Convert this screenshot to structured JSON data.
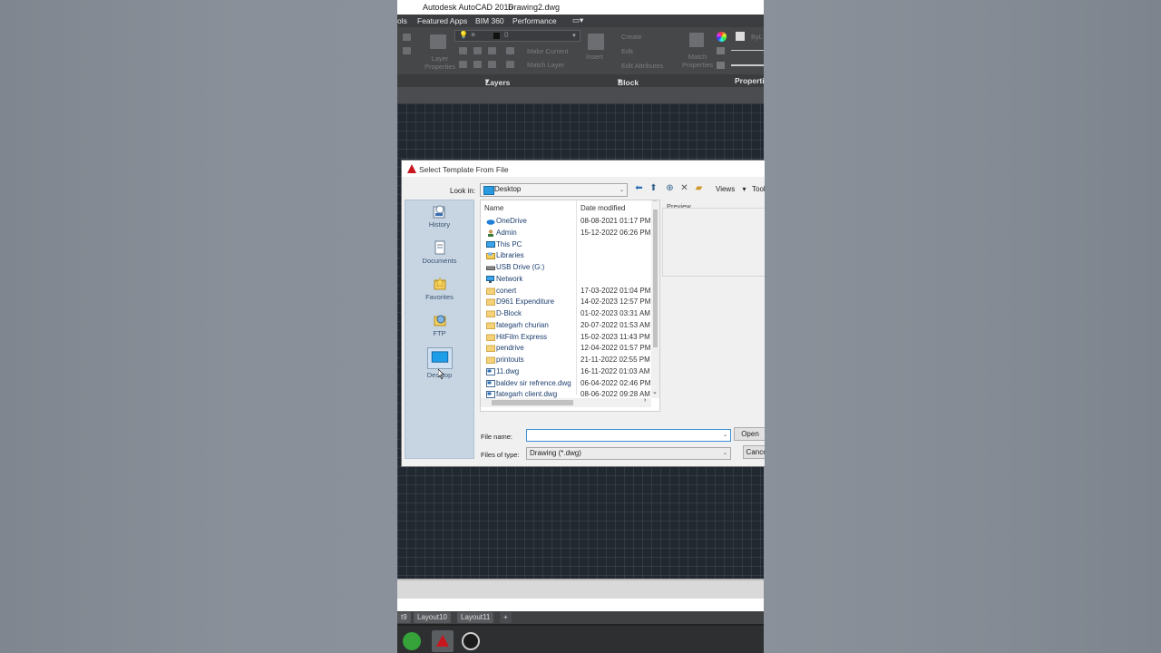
{
  "window": {
    "app_title": "Autodesk AutoCAD 2016",
    "doc_title": "Drawing2.dwg"
  },
  "menubar": {
    "items": [
      "ols",
      "Featured Apps",
      "BIM 360",
      "Performance"
    ]
  },
  "ribbon": {
    "layers_panel": "Layers",
    "block_panel": "Block",
    "properties_panel": "Properties",
    "layer_properties": "Layer Properties",
    "layer_value": "0",
    "make_current": "Make Current",
    "match_layer": "Match Layer",
    "insert": "Insert",
    "create": "Create",
    "edit": "Edit",
    "edit_attributes": "Edit Attributes",
    "match_properties": "Match Properties",
    "bylayer": "ByL"
  },
  "dialog": {
    "title": "Select Template From File",
    "look_in_label": "Look in:",
    "look_in_value": "Desktop",
    "views_label": "Views",
    "tools_label": "Tools",
    "places": [
      "History",
      "Documents",
      "Favorites",
      "FTP",
      "Desktop"
    ],
    "columns": {
      "name": "Name",
      "date": "Date modified"
    },
    "files": [
      {
        "name": "OneDrive",
        "date": "08-08-2021 01:17 PM",
        "icon": "cloud"
      },
      {
        "name": "Admin",
        "date": "15-12-2022 06:26 PM",
        "icon": "user"
      },
      {
        "name": "This PC",
        "date": "",
        "icon": "pc"
      },
      {
        "name": "Libraries",
        "date": "",
        "icon": "library"
      },
      {
        "name": "USB Drive (G:)",
        "date": "",
        "icon": "drive"
      },
      {
        "name": "Network",
        "date": "",
        "icon": "network"
      },
      {
        "name": "conert",
        "date": "17-03-2022 01:04 PM",
        "icon": "folder"
      },
      {
        "name": "D961 Expenditure",
        "date": "14-02-2023 12:57 PM",
        "icon": "folder"
      },
      {
        "name": "D-Block",
        "date": "01-02-2023 03:31 AM",
        "icon": "folder"
      },
      {
        "name": "fategarh churian",
        "date": "20-07-2022 01:53 AM",
        "icon": "folder"
      },
      {
        "name": "HitFilm Express",
        "date": "15-02-2023 11:43 PM",
        "icon": "folder"
      },
      {
        "name": "pendrive",
        "date": "12-04-2022 01:57 PM",
        "icon": "folder"
      },
      {
        "name": "printouts",
        "date": "21-11-2022 02:55 PM",
        "icon": "folder"
      },
      {
        "name": "11.dwg",
        "date": "16-11-2022 01:03 AM",
        "icon": "dwg"
      },
      {
        "name": "baldev sir refrence.dwg",
        "date": "06-04-2022 02:46 PM",
        "icon": "dwg"
      },
      {
        "name": "fategarh client.dwg",
        "date": "08-06-2022 09:28 AM",
        "icon": "dwg"
      }
    ],
    "preview_label": "Preview",
    "file_name_label": "File name:",
    "file_name_value": "",
    "files_of_type_label": "Files of type:",
    "files_of_type_value": "Drawing (*.dwg)",
    "open_button": "Open",
    "cancel_button": "Cancel"
  },
  "layout_tabs": [
    "t9",
    "Layout10",
    "Layout11",
    "+"
  ],
  "colors": {
    "autocad_red": "#c8171e",
    "canvas": "#212830",
    "places_bg": "#c7d5e3",
    "folder": "#f5d27a"
  }
}
